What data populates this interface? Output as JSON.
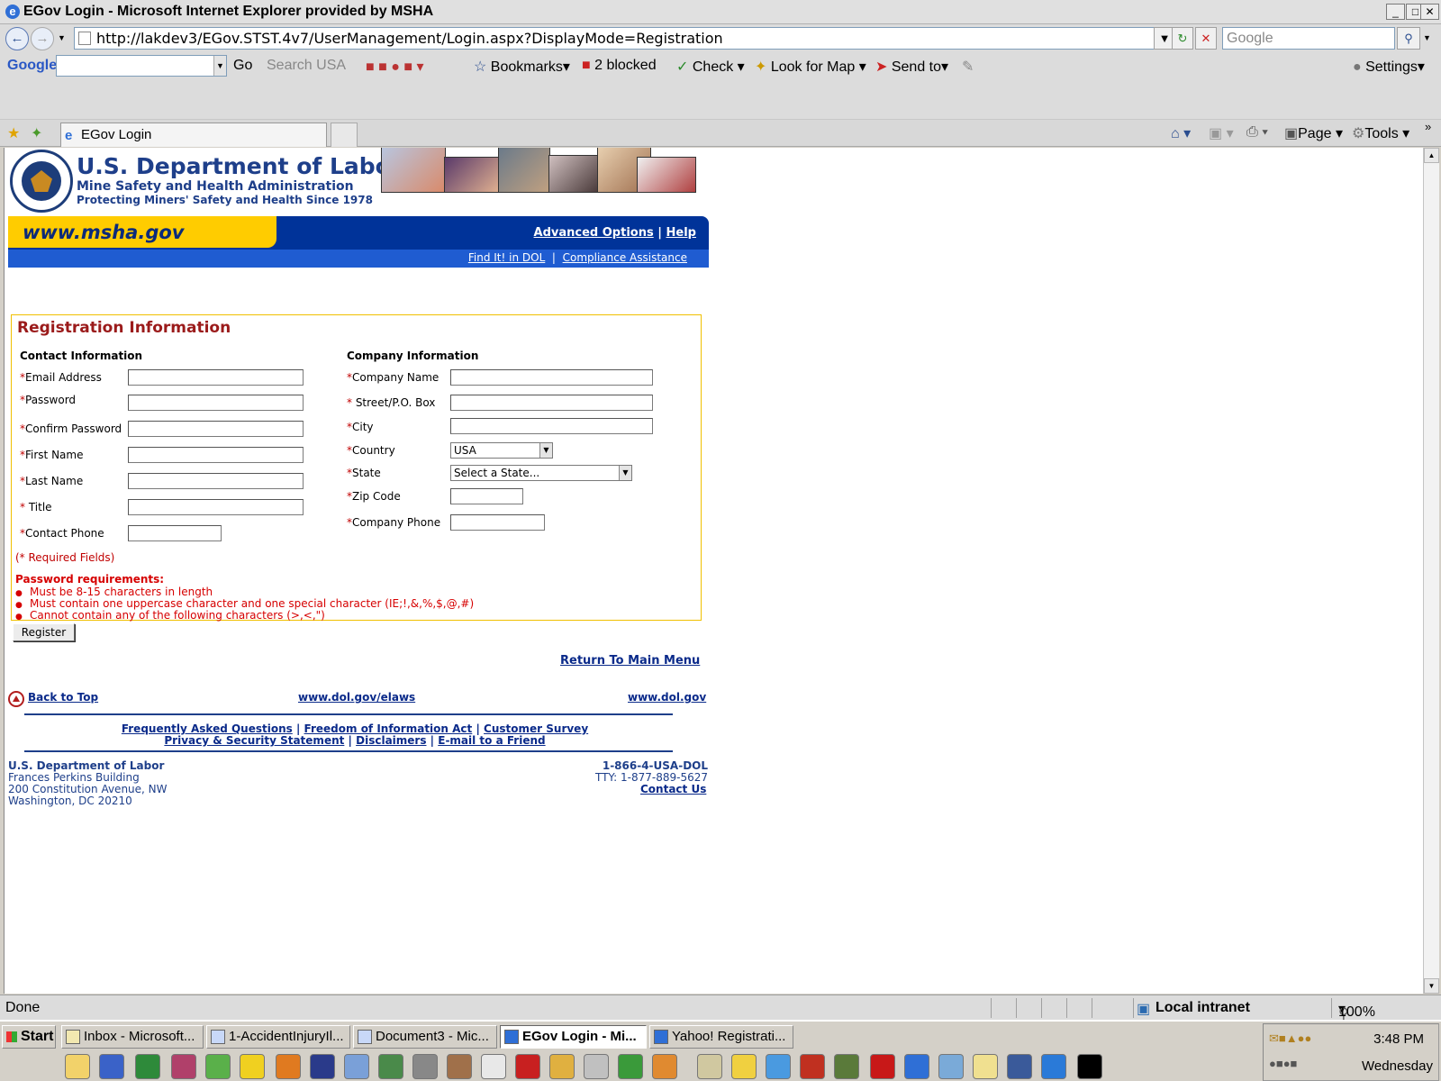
{
  "window": {
    "title": "EGov Login - Microsoft Internet Explorer provided by MSHA"
  },
  "address_bar": {
    "url": "http://lakdev3/EGov.STST.4v7/UserManagement/Login.aspx?DisplayMode=Registration",
    "search_placeholder": "Google"
  },
  "google_toolbar": {
    "logo": "Google",
    "go": "Go",
    "search_usa": "Search USA",
    "bookmarks": "Bookmarks",
    "blocked": "2 blocked",
    "check": "Check",
    "look_for_map": "Look for Map",
    "send_to": "Send to",
    "settings": "Settings"
  },
  "tab_row": {
    "tab_label": "EGov Login",
    "page": "Page",
    "tools": "Tools"
  },
  "header": {
    "dol": "U.S. Department of Labor",
    "msha": "Mine Safety and Health Administration",
    "tagline": "Protecting Miners' Safety and Health Since 1978",
    "site": "www.msha.gov",
    "advanced_options": "Advanced Options",
    "help": "Help",
    "pipe": "|",
    "find_it": "Find It! in DOL",
    "compliance": "Compliance Assistance"
  },
  "form": {
    "heading": "Registration Information",
    "contact_heading": "Contact Information",
    "company_heading": "Company Information",
    "star": "*",
    "contact_fields": [
      {
        "label": "Email Address",
        "value": ""
      },
      {
        "label": "Password",
        "value": ""
      },
      {
        "label": "Confirm Password",
        "value": ""
      },
      {
        "label": "First Name",
        "value": ""
      },
      {
        "label": "Last Name",
        "value": ""
      },
      {
        "label": " Title",
        "value": ""
      },
      {
        "label": "Contact Phone",
        "value": ""
      }
    ],
    "company_fields": [
      {
        "label": "Company Name",
        "value": ""
      },
      {
        "label": " Street/P.O. Box",
        "value": ""
      },
      {
        "label": "City",
        "value": ""
      },
      {
        "label": "Country",
        "value": "USA"
      },
      {
        "label": "State",
        "value": "Select a State..."
      },
      {
        "label": "Zip Code",
        "value": ""
      },
      {
        "label": "Company Phone",
        "value": ""
      }
    ],
    "required_note": "(* Required Fields)",
    "pw_heading": "Password requirements:",
    "pw_rules": [
      "Must be 8-15 characters in length",
      "Must contain one uppercase character and one special character (IE;!,&,%,$,@,#)",
      "Cannot contain any of the following characters (>,<,\")"
    ],
    "register": "Register"
  },
  "footer": {
    "return_main": "Return To Main Menu",
    "back_to_top": "Back to Top",
    "elaws": "www.dol.gov/elaws",
    "dolgov": "www.dol.gov",
    "row1": [
      "Frequently Asked Questions",
      "Freedom of Information Act",
      "Customer Survey"
    ],
    "row2": [
      "Privacy & Security Statement",
      "Disclaimers",
      "E-mail to a Friend"
    ],
    "sep": "|",
    "org": "U.S. Department of Labor",
    "addr1": "Frances Perkins Building",
    "addr2": "200 Constitution Avenue, NW",
    "addr3": "Washington, DC 20210",
    "phone": "1-866-4-USA-DOL",
    "tty": "TTY: 1-877-889-5627",
    "contact": "Contact Us"
  },
  "status_bar": {
    "status": "Done",
    "zone": "Local intranet",
    "zoom": "100%"
  },
  "taskbar": {
    "start": "Start",
    "tasks": [
      "Inbox - Microsoft...",
      "1-AccidentInjuryIl...",
      "Document3 - Mic...",
      "EGov Login - Mi...",
      "Yahoo! Registrati..."
    ],
    "time": "3:48 PM",
    "day": "Wednesday"
  }
}
